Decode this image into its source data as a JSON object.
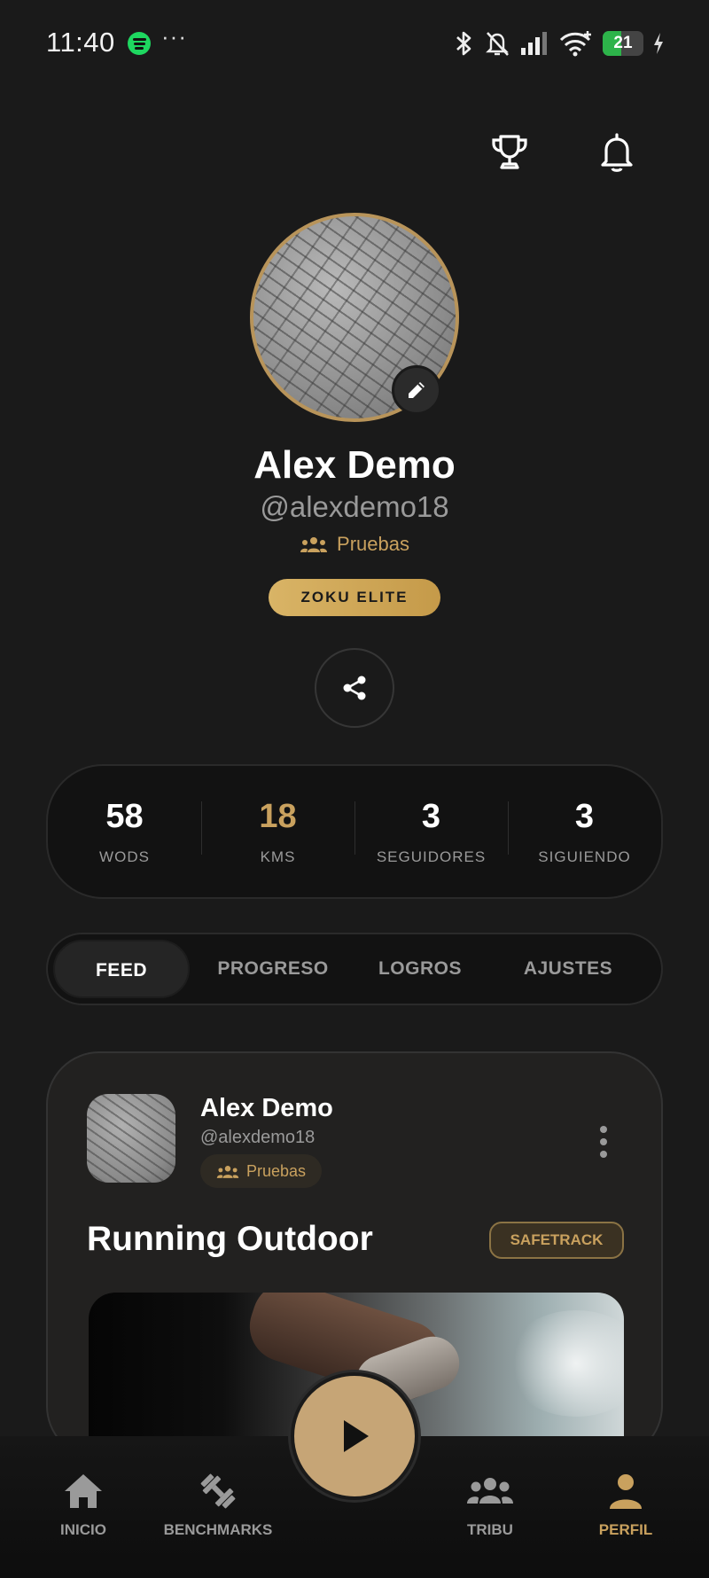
{
  "status_bar": {
    "time": "11:40",
    "more": "···",
    "battery_level": "21",
    "battery_percent": 21
  },
  "profile": {
    "name": "Alex Demo",
    "handle": "@alexdemo18",
    "group": "Pruebas",
    "badge": "ZOKU ELITE"
  },
  "stats": [
    {
      "value": "58",
      "label": "WODS"
    },
    {
      "value": "18",
      "label": "KMS"
    },
    {
      "value": "3",
      "label": "SEGUIDORES"
    },
    {
      "value": "3",
      "label": "SIGUIENDO"
    }
  ],
  "tabs": [
    "FEED",
    "PROGRESO",
    "LOGROS",
    "AJUSTES"
  ],
  "post": {
    "author_name": "Alex Demo",
    "author_handle": "@alexdemo18",
    "group": "Pruebas",
    "title": "Running Outdoor",
    "tag": "SAFETRACK"
  },
  "nav": {
    "inicio": "INICIO",
    "benchmarks": "BENCHMARKS",
    "tribu": "TRIBU",
    "perfil": "PERFIL"
  },
  "colors": {
    "accent": "#c9a15e",
    "background": "#1a1a1a",
    "battery": "#2db34a",
    "spotify": "#1ed760"
  },
  "icons": {
    "header": [
      "trophy-icon",
      "bell-icon"
    ],
    "profile": [
      "edit-icon",
      "group-icon",
      "share-icon"
    ],
    "nav": [
      "home-icon",
      "dumbbell-icon",
      "play-icon",
      "group-icon",
      "person-icon"
    ]
  }
}
